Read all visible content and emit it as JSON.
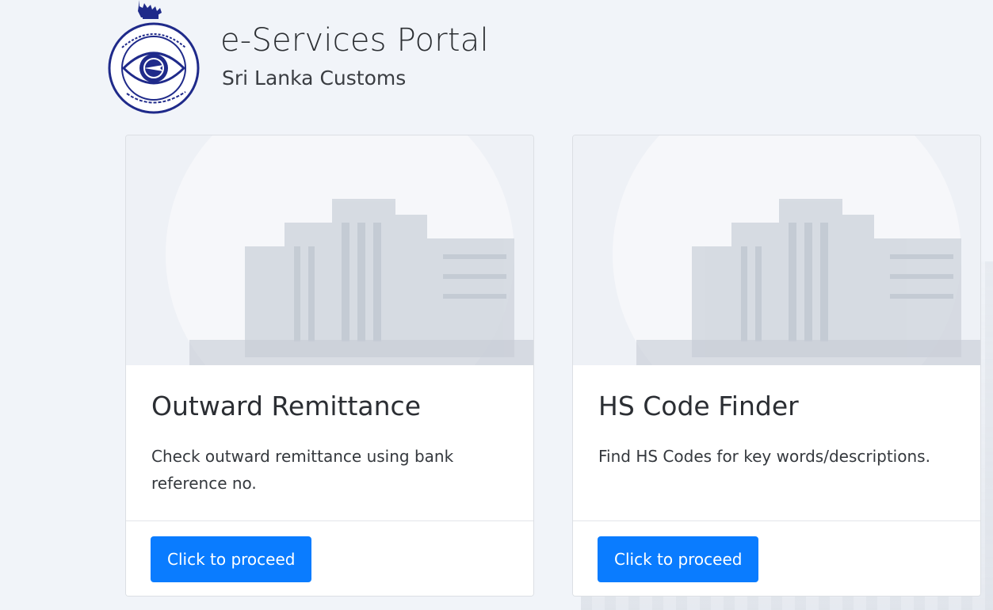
{
  "header": {
    "title": "e-Services Portal",
    "subtitle": "Sri Lanka Customs",
    "logo_text": "SRI LANKA CUSTOMS"
  },
  "cards": [
    {
      "title": "Outward Remittance",
      "description": "Check outward remittance using bank reference no.",
      "button_label": "Click to proceed"
    },
    {
      "title": "HS Code Finder",
      "description": "Find HS Codes for key words/descriptions.",
      "button_label": "Click to proceed"
    }
  ],
  "colors": {
    "accent": "#0a7cff",
    "logo": "#1f2a8a"
  }
}
